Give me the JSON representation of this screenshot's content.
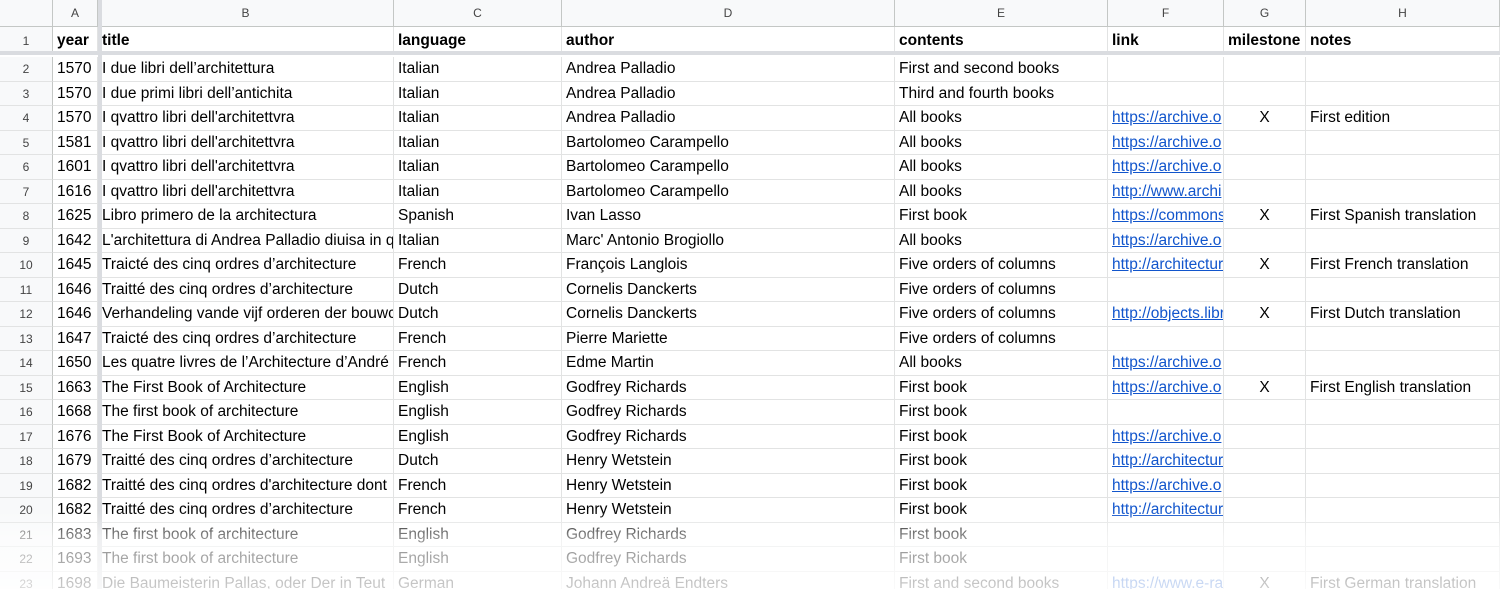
{
  "columns": [
    "A",
    "B",
    "C",
    "D",
    "E",
    "F",
    "G",
    "H"
  ],
  "header_row": {
    "number": "1",
    "cells": [
      "year",
      "title",
      "language",
      "author",
      "contents",
      "link",
      "milestone",
      "notes"
    ]
  },
  "rows": [
    {
      "number": "2",
      "cells": [
        "1570",
        "I due libri dell’architettura",
        "Italian",
        "Andrea Palladio",
        "First and second books",
        "",
        "",
        ""
      ]
    },
    {
      "number": "3",
      "cells": [
        "1570",
        "I due primi libri dell’antichita",
        "Italian",
        "Andrea Palladio",
        "Third and fourth books",
        "",
        "",
        ""
      ]
    },
    {
      "number": "4",
      "cells": [
        "1570",
        "I qvattro libri dell'architettvra",
        "Italian",
        "Andrea Palladio",
        "All books",
        "https://archive.o",
        "X",
        "First edition"
      ]
    },
    {
      "number": "5",
      "cells": [
        "1581",
        "I qvattro libri dell'architettvra",
        "Italian",
        "Bartolomeo Carampello",
        "All books",
        "https://archive.o",
        "",
        ""
      ]
    },
    {
      "number": "6",
      "cells": [
        "1601",
        "I qvattro libri dell'architettvra",
        "Italian",
        "Bartolomeo Carampello",
        "All books",
        "https://archive.o",
        "",
        ""
      ]
    },
    {
      "number": "7",
      "cells": [
        "1616",
        "I qvattro libri dell'architettvra",
        "Italian",
        "Bartolomeo Carampello",
        "All books",
        "http://www.archi",
        "",
        ""
      ]
    },
    {
      "number": "8",
      "cells": [
        "1625",
        "Libro primero de la architectura",
        "Spanish",
        "Ivan Lasso",
        "First book",
        "https://commons",
        "X",
        "First Spanish translation"
      ]
    },
    {
      "number": "9",
      "cells": [
        "1642",
        "L'architettura di Andrea Palladio diuisa in q",
        "Italian",
        "Marc' Antonio Brogiollo",
        "All books",
        "https://archive.o",
        "",
        ""
      ]
    },
    {
      "number": "10",
      "cells": [
        "1645",
        "Traicté des cinq ordres d’architecture",
        "French",
        "François Langlois",
        "Five orders of columns",
        "http://architectur",
        "X",
        "First French translation"
      ]
    },
    {
      "number": "11",
      "cells": [
        "1646",
        "Traitté des cinq ordres d’architecture",
        "Dutch",
        "Cornelis Danckerts",
        "Five orders of columns",
        "",
        "",
        ""
      ]
    },
    {
      "number": "12",
      "cells": [
        "1646",
        "Verhandeling vande vijf orderen der bouwc",
        "Dutch",
        "Cornelis Danckerts",
        "Five orders of columns",
        "http://objects.libr",
        "X",
        "First Dutch translation"
      ]
    },
    {
      "number": "13",
      "cells": [
        "1647",
        "Traicté des cinq ordres d’architecture",
        "French",
        "Pierre Mariette",
        "Five orders of columns",
        "",
        "",
        ""
      ]
    },
    {
      "number": "14",
      "cells": [
        "1650",
        "Les quatre livres de l’Architecture d’André",
        "French",
        "Edme Martin",
        "All books",
        "https://archive.o",
        "",
        ""
      ]
    },
    {
      "number": "15",
      "cells": [
        "1663",
        "The First Book of Architecture",
        "English",
        "Godfrey Richards",
        "First book",
        "https://archive.o",
        "X",
        "First English translation"
      ]
    },
    {
      "number": "16",
      "cells": [
        "1668",
        "The first book of architecture",
        "English",
        "Godfrey Richards",
        "First book",
        "",
        "",
        ""
      ]
    },
    {
      "number": "17",
      "cells": [
        "1676",
        "The First Book of Architecture",
        "English",
        "Godfrey Richards",
        "First book",
        "https://archive.o",
        "",
        ""
      ]
    },
    {
      "number": "18",
      "cells": [
        "1679",
        "Traitté des cinq ordres d’architecture",
        "Dutch",
        "Henry Wetstein",
        "First book",
        "http://architectur",
        "",
        ""
      ]
    },
    {
      "number": "19",
      "cells": [
        "1682",
        "Traitté des cinq ordres d'architecture dont",
        "French",
        "Henry Wetstein",
        "First book",
        "https://archive.o",
        "",
        ""
      ]
    },
    {
      "number": "20",
      "cells": [
        "1682",
        "Traitté des cinq ordres d’architecture",
        "French",
        "Henry Wetstein",
        "First book",
        "http://architectur",
        "",
        ""
      ]
    },
    {
      "number": "21",
      "cells": [
        "1683",
        "The first book of architecture",
        "English",
        "Godfrey Richards",
        "First book",
        "",
        "",
        ""
      ]
    },
    {
      "number": "22",
      "cells": [
        "1693",
        "The first book of architecture",
        "English",
        "Godfrey Richards",
        "First book",
        "",
        "",
        ""
      ]
    },
    {
      "number": "23",
      "cells": [
        "1698",
        "Die Baumeisterin Pallas, oder Der in Teut",
        "German",
        "Johann Andreä Endters",
        "First and second books",
        "https://www.e-ra",
        "X",
        "First German translation"
      ]
    }
  ],
  "colors": {
    "link": "#1155cc",
    "header_bg": "#f8f9fa",
    "gridline": "#e2e3e3",
    "freeze_bar": "#dadce0"
  }
}
